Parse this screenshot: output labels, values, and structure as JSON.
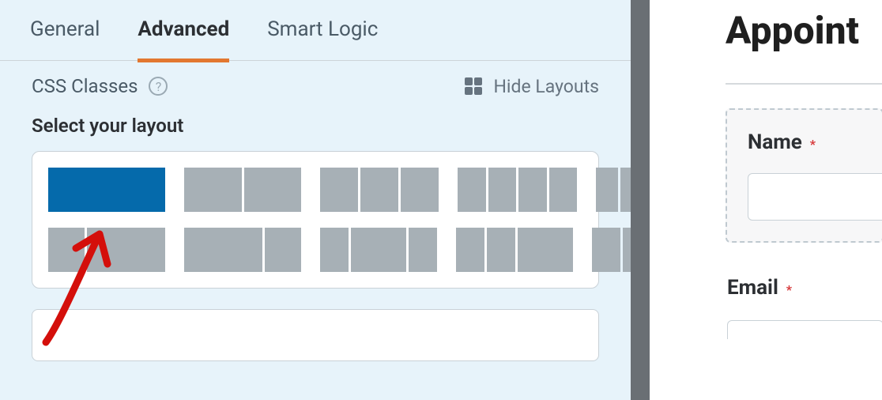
{
  "tabs": {
    "general": "General",
    "advanced": "Advanced",
    "smart_logic": "Smart Logic"
  },
  "css_classes_label": "CSS Classes",
  "hide_layouts_label": "Hide Layouts",
  "select_layout_label": "Select your layout",
  "css_input_value": "",
  "preview": {
    "title": "Appoint",
    "name_label": "Name",
    "email_label": "Email",
    "required_marker": "*"
  }
}
